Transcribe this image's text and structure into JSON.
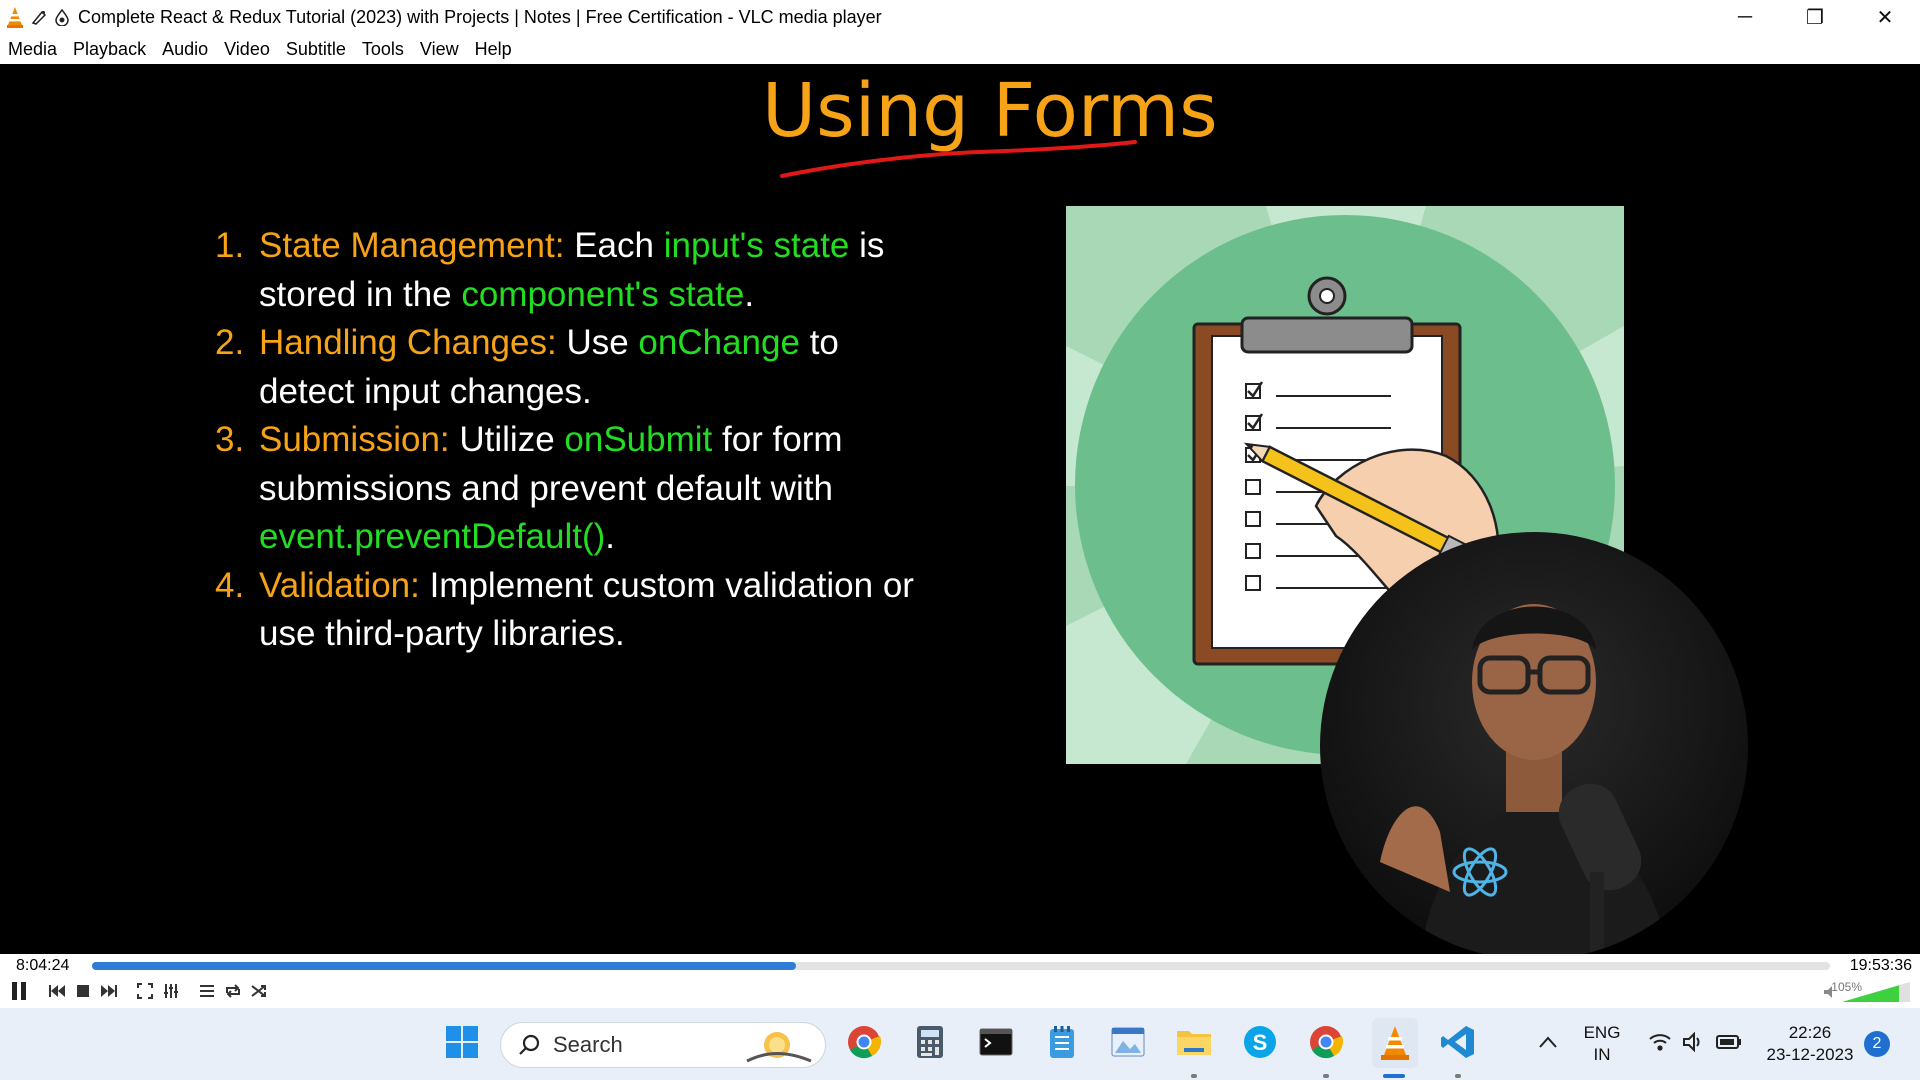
{
  "window": {
    "title": "Complete React & Redux Tutorial (2023) with Projects | Notes | Free Certification - VLC media player",
    "minimize": "─",
    "restore": "❐",
    "close": "✕"
  },
  "menu": [
    "Media",
    "Playback",
    "Audio",
    "Video",
    "Subtitle",
    "Tools",
    "View",
    "Help"
  ],
  "slide": {
    "title": "Using Forms",
    "points": [
      {
        "num": "1.",
        "head": "State Management:",
        "parts": [
          {
            "t": " Each ",
            "c": "w"
          },
          {
            "t": "input's state",
            "c": "g"
          },
          {
            "t": " is stored in the ",
            "c": "w"
          },
          {
            "t": "component's state",
            "c": "g"
          },
          {
            "t": ".",
            "c": "w"
          }
        ]
      },
      {
        "num": "2.",
        "head": "Handling Changes:",
        "parts": [
          {
            "t": " Use ",
            "c": "w"
          },
          {
            "t": "onChange",
            "c": "g"
          },
          {
            "t": " to detect input changes.",
            "c": "w"
          }
        ]
      },
      {
        "num": "3.",
        "head": "Submission:",
        "parts": [
          {
            "t": " Utilize ",
            "c": "w"
          },
          {
            "t": "onSubmit",
            "c": "g"
          },
          {
            "t": " for form submissions and prevent default with ",
            "c": "w"
          },
          {
            "t": "event.preventDefault()",
            "c": "g"
          },
          {
            "t": ".",
            "c": "w"
          }
        ]
      },
      {
        "num": "4.",
        "head": "Validation:",
        "parts": [
          {
            "t": " Implement custom validation or use third-party libraries.",
            "c": "w"
          }
        ]
      }
    ]
  },
  "player": {
    "elapsed": "8:04:24",
    "total": "19:53:36",
    "progress": 0.405,
    "volume_label": "105%",
    "volume": 1.05
  },
  "taskbar": {
    "search_placeholder": "Search",
    "lang_top": "ENG",
    "lang_bottom": "IN",
    "time": "22:26",
    "date": "23-12-2023",
    "notifications": "2"
  },
  "colors": {
    "accent_orange": "#f7a318",
    "keyword_green": "#22dd22",
    "seek_blue": "#2f7cd7"
  }
}
